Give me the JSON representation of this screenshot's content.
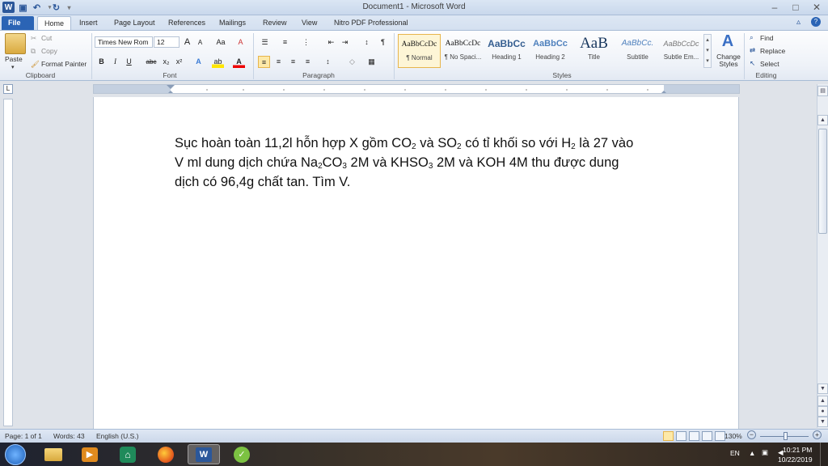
{
  "window": {
    "title": "Document1 - Microsoft Word",
    "controls": {
      "minimize": "–",
      "maximize": "□",
      "close": "✕"
    }
  },
  "tabs": [
    "File",
    "Home",
    "Insert",
    "Page Layout",
    "References",
    "Mailings",
    "Review",
    "View",
    "Nitro PDF Professional"
  ],
  "ribbon": {
    "clipboard": {
      "label": "Clipboard",
      "paste": "Paste",
      "cut": "Cut",
      "copy": "Copy",
      "format_painter": "Format Painter"
    },
    "font": {
      "label": "Font",
      "font_name": "Times New Rom",
      "font_size": "12",
      "bold": "B",
      "italic": "I",
      "underline": "U",
      "strike": "abc",
      "subscript": "x₂",
      "superscript": "x²",
      "grow": "A",
      "shrink": "A",
      "case": "Aa",
      "clear": "A"
    },
    "paragraph": {
      "label": "Paragraph",
      "pilcrow": "¶"
    },
    "styles": {
      "label": "Styles",
      "items": [
        {
          "preview": "AaBbCcDc",
          "name": "¶ Normal"
        },
        {
          "preview": "AaBbCcDc",
          "name": "¶ No Spaci..."
        },
        {
          "preview": "AaBbCc",
          "name": "Heading 1"
        },
        {
          "preview": "AaBbCc",
          "name": "Heading 2"
        },
        {
          "preview": "AaB",
          "name": "Title"
        },
        {
          "preview": "AaBbCc.",
          "name": "Subtitle"
        },
        {
          "preview": "AaBbCcDc",
          "name": "Subtle Em..."
        }
      ],
      "change_styles": "Change Styles"
    },
    "editing": {
      "label": "Editing",
      "find": "Find",
      "replace": "Replace",
      "select": "Select"
    }
  },
  "document": {
    "line1_a": "Sục hoàn toàn 11,2l hỗn hợp X gồm CO",
    "line1_sub1": "2",
    "line1_b": " và SO",
    "line1_sub2": "2",
    "line1_c": " có tỉ khối so với H",
    "line1_sub3": "2",
    "line1_d": " là 27 vào",
    "line2_a": "V ml dung dịch chứa Na",
    "line2_sub1": "2",
    "line2_b": "CO",
    "line2_sub2": "3",
    "line2_c": " 2M và KHSO",
    "line2_sub3": "3",
    "line2_d": " 2M và KOH 4M thu được dung",
    "line3": "dịch có 96,4g chất tan. Tìm V."
  },
  "status": {
    "page": "Page: 1 of 1",
    "words": "Words: 43",
    "language": "English (U.S.)",
    "zoom": "130%"
  },
  "taskbar": {
    "lang": "EN",
    "time": "10:21 PM",
    "date": "10/22/2019"
  },
  "colors": {
    "file_tab": "#2b64b5",
    "word_blue": "#2b579a",
    "style_selected": "#fdf5d6"
  }
}
